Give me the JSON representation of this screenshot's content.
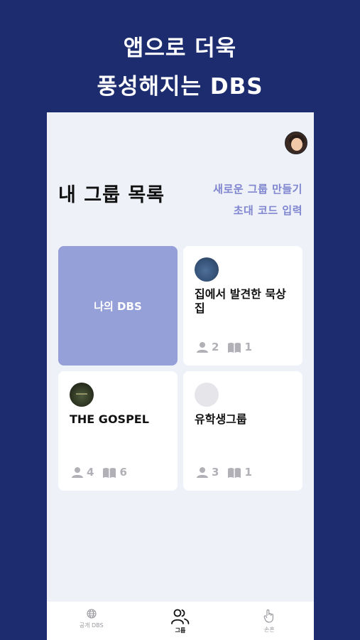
{
  "promo": {
    "line1": "앱으로 더욱",
    "line2": "풍성해지는 DBS"
  },
  "header": {
    "title": "내 그룹 목록",
    "create_group_label": "새로운 그룹 만들기",
    "invite_code_label": "초대 코드 입력"
  },
  "groups": [
    {
      "title": "나의 DBS"
    },
    {
      "title": "집에서 발견한 묵상집",
      "members": "2",
      "books": "1"
    },
    {
      "title": "THE GOSPEL",
      "members": "4",
      "books": "6"
    },
    {
      "title": "유학생그룹",
      "members": "3",
      "books": "1"
    }
  ],
  "tabbar": {
    "tabs": [
      {
        "label": "공개 DBS",
        "icon": "globe-icon"
      },
      {
        "label": "그룹",
        "icon": "people-icon"
      },
      {
        "label": "손흔",
        "icon": "hand-icon"
      }
    ],
    "active_index": 1
  },
  "colors": {
    "background": "#1c2c6e",
    "accent": "#7f86cf",
    "my_dbs_card": "#959fd8"
  }
}
